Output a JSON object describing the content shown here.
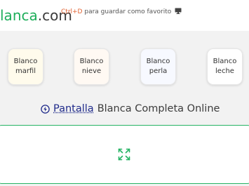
{
  "header": {
    "logo_main": "lanca",
    "logo_tld": ".com",
    "shortcut_keys": "Ctrl+D",
    "shortcut_text": " para guardar como favorito",
    "icon": "monitor-icon"
  },
  "cards": [
    {
      "line1": "Blanco",
      "line2": "marfil"
    },
    {
      "line1": "Blanco",
      "line2": "nieve"
    },
    {
      "line1": "Blanco",
      "line2": "perla"
    },
    {
      "line1": "Blanco",
      "line2": "leche"
    }
  ],
  "title": {
    "icon": "bolt-icon",
    "link": "Pantalla",
    "rest": "Blanca Completa Online"
  },
  "panel": {
    "icon": "expand-icon"
  },
  "colors": {
    "accent": "#1fae5b",
    "link": "#1f2a8a",
    "shortcut": "#e06030"
  }
}
